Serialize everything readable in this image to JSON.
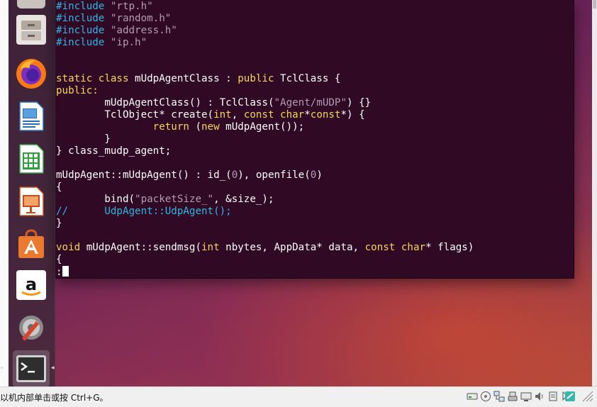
{
  "launcher": {
    "items": [
      {
        "name": "files"
      },
      {
        "name": "firefox"
      },
      {
        "name": "writer"
      },
      {
        "name": "calc"
      },
      {
        "name": "impress"
      },
      {
        "name": "software"
      },
      {
        "name": "amazon"
      },
      {
        "name": "settings"
      },
      {
        "name": "terminal"
      }
    ]
  },
  "terminal": {
    "lines": [
      {
        "parts": [
          {
            "c": "pre",
            "t": "#include "
          },
          {
            "c": "str",
            "t": "\"rtp.h\""
          }
        ]
      },
      {
        "parts": [
          {
            "c": "pre",
            "t": "#include "
          },
          {
            "c": "str",
            "t": "\"random.h\""
          }
        ]
      },
      {
        "parts": [
          {
            "c": "pre",
            "t": "#include "
          },
          {
            "c": "str",
            "t": "\"address.h\""
          }
        ]
      },
      {
        "parts": [
          {
            "c": "pre",
            "t": "#include "
          },
          {
            "c": "str",
            "t": "\"ip.h\""
          }
        ]
      },
      {
        "parts": []
      },
      {
        "parts": []
      },
      {
        "parts": [
          {
            "c": "kw",
            "t": "static class"
          },
          {
            "c": "",
            "t": " mUdpAgentClass : "
          },
          {
            "c": "kw",
            "t": "public"
          },
          {
            "c": "",
            "t": " TclClass {"
          }
        ]
      },
      {
        "parts": [
          {
            "c": "kw",
            "t": "public:"
          }
        ]
      },
      {
        "parts": [
          {
            "c": "",
            "t": "        mUdpAgentClass() : TclClass("
          },
          {
            "c": "str",
            "t": "\"Agent/mUDP\""
          },
          {
            "c": "",
            "t": ") {}"
          }
        ]
      },
      {
        "parts": [
          {
            "c": "",
            "t": "        TclObject* create("
          },
          {
            "c": "kw",
            "t": "int"
          },
          {
            "c": "",
            "t": ", "
          },
          {
            "c": "kw",
            "t": "const char"
          },
          {
            "c": "",
            "t": "*"
          },
          {
            "c": "kw",
            "t": "const"
          },
          {
            "c": "",
            "t": "*) {"
          }
        ]
      },
      {
        "parts": [
          {
            "c": "",
            "t": "                "
          },
          {
            "c": "kw",
            "t": "return"
          },
          {
            "c": "",
            "t": " ("
          },
          {
            "c": "kw",
            "t": "new"
          },
          {
            "c": "",
            "t": " mUdpAgent());"
          }
        ]
      },
      {
        "parts": [
          {
            "c": "",
            "t": "        }"
          }
        ]
      },
      {
        "parts": [
          {
            "c": "",
            "t": "} class_mudp_agent;"
          }
        ]
      },
      {
        "parts": []
      },
      {
        "parts": [
          {
            "c": "",
            "t": "mUdpAgent::mUdpAgent() : id_("
          },
          {
            "c": "str",
            "t": "0"
          },
          {
            "c": "",
            "t": "), openfile("
          },
          {
            "c": "str",
            "t": "0"
          },
          {
            "c": "",
            "t": ")"
          }
        ]
      },
      {
        "parts": [
          {
            "c": "",
            "t": "{"
          }
        ]
      },
      {
        "parts": [
          {
            "c": "",
            "t": "        bind("
          },
          {
            "c": "str",
            "t": "\"packetSize_\""
          },
          {
            "c": "",
            "t": ", &size_);"
          }
        ]
      },
      {
        "parts": [
          {
            "c": "cmt",
            "t": "//      UdpAgent::UdpAgent();"
          }
        ]
      },
      {
        "parts": [
          {
            "c": "",
            "t": "}"
          }
        ]
      },
      {
        "parts": []
      },
      {
        "parts": [
          {
            "c": "kw",
            "t": "void"
          },
          {
            "c": "",
            "t": " mUdpAgent::sendmsg("
          },
          {
            "c": "kw",
            "t": "int"
          },
          {
            "c": "",
            "t": " nbytes, AppData* data, "
          },
          {
            "c": "kw",
            "t": "const char"
          },
          {
            "c": "",
            "t": "* flags)"
          }
        ]
      },
      {
        "parts": [
          {
            "c": "",
            "t": "{"
          }
        ]
      },
      {
        "parts": [
          {
            "c": "",
            "t": ":"
          }
        ],
        "cursor": true
      }
    ]
  },
  "statusbar": {
    "text": "以机内部单击或按 Ctrl+G。",
    "icons": [
      "hdd-icon",
      "optical-icon",
      "network-icon",
      "usb-icon",
      "shared-folder-icon",
      "display-icon",
      "recording-icon",
      "mouse-integration-icon",
      "host-key-icon"
    ]
  }
}
